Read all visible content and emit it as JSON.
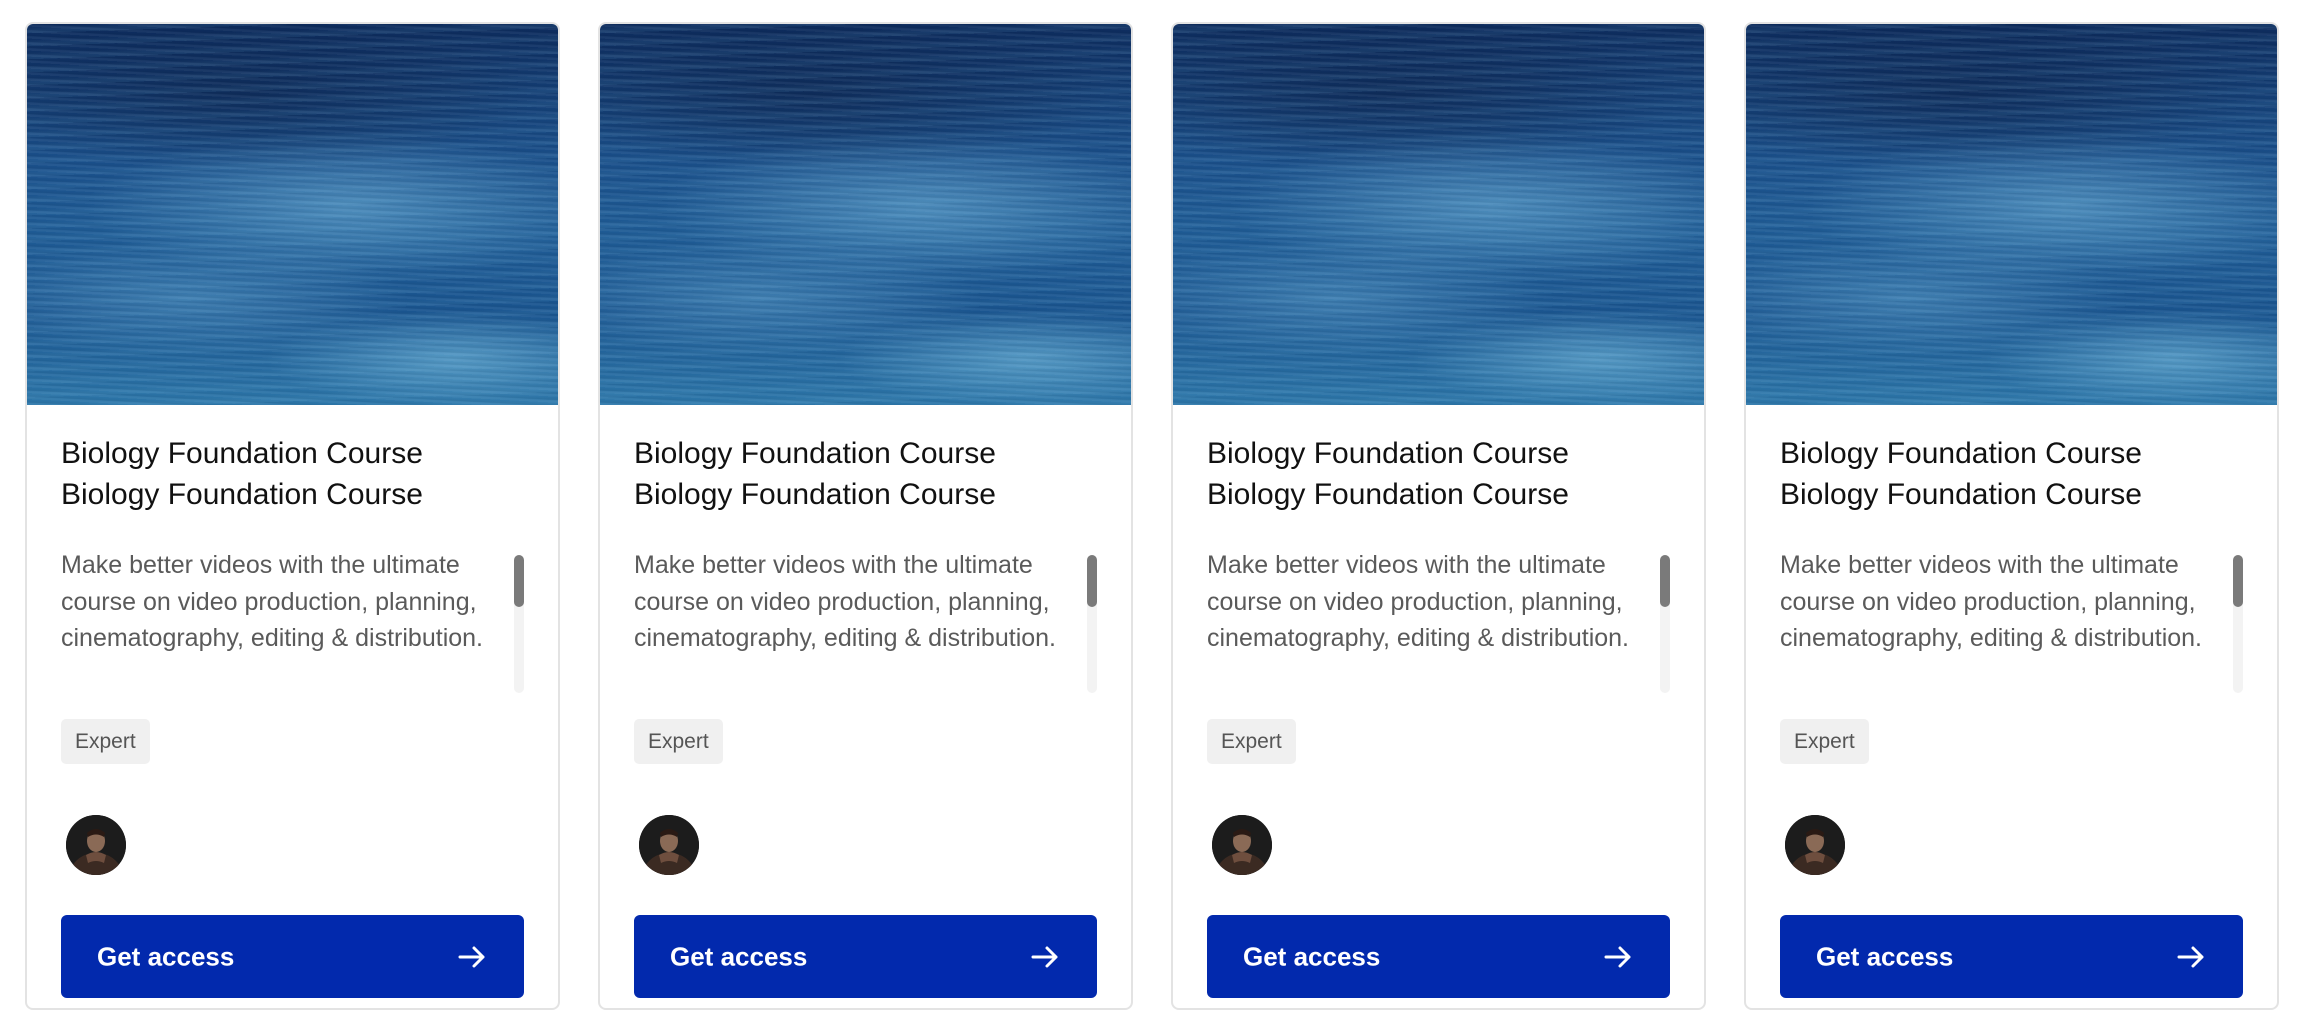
{
  "cards": [
    {
      "title": "Biology Foundation Course Biology Foundation Course",
      "description": "Make better videos with the ultimate course on video production, planning, cinematography, editing & distribution.",
      "level_badge": "Expert",
      "cta_label": "Get access",
      "cta_icon": "arrow-right-icon",
      "avatar_icon": "instructor-avatar"
    },
    {
      "title": "Biology Foundation Course Biology Foundation Course",
      "description": "Make better videos with the ultimate course on video production, planning, cinematography, editing & distribution.",
      "level_badge": "Expert",
      "cta_label": "Get access",
      "cta_icon": "arrow-right-icon",
      "avatar_icon": "instructor-avatar"
    },
    {
      "title": "Biology Foundation Course Biology Foundation Course",
      "description": "Make better videos with the ultimate course on video production, planning, cinematography, editing & distribution.",
      "level_badge": "Expert",
      "cta_label": "Get access",
      "cta_icon": "arrow-right-icon",
      "avatar_icon": "instructor-avatar"
    },
    {
      "title": "Biology Foundation Course Biology Foundation Course",
      "description": "Make better videos with the ultimate course on video production, planning, cinematography, editing & distribution.",
      "level_badge": "Expert",
      "cta_label": "Get access",
      "cta_icon": "arrow-right-icon",
      "avatar_icon": "instructor-avatar"
    }
  ],
  "colors": {
    "cta_background": "#0229ad",
    "cta_text": "#ffffff",
    "title_text": "#111111",
    "description_text": "#5a5a5a",
    "badge_background": "#f0f0f0",
    "card_border": "#e3e3e3"
  }
}
